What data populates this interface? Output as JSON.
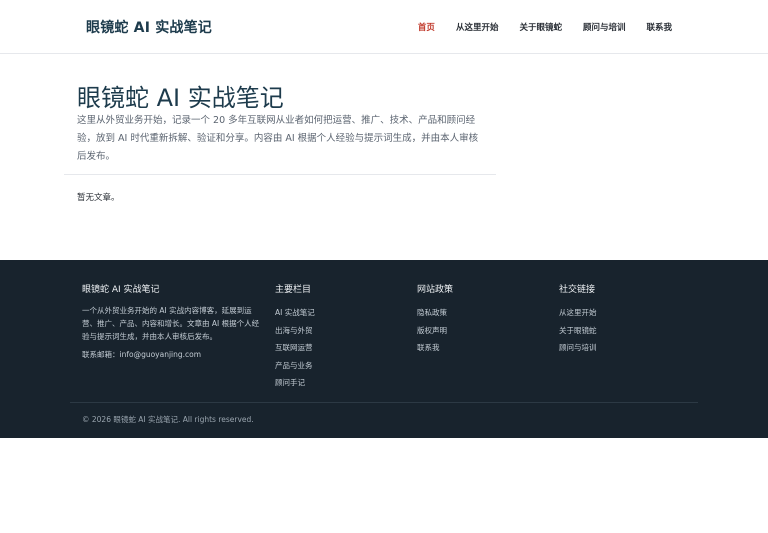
{
  "header": {
    "brand": "眼镜蛇 AI 实战笔记",
    "nav": [
      {
        "label": "首页",
        "active": true
      },
      {
        "label": "从这里开始"
      },
      {
        "label": "关于眼镜蛇"
      },
      {
        "label": "顾问与培训"
      },
      {
        "label": "联系我"
      }
    ]
  },
  "main": {
    "title": "眼镜蛇 AI 实战笔记",
    "description": "这里从外贸业务开始，记录一个 20 多年互联网从业者如何把运营、推广、技术、产品和顾问经验，放到 AI 时代重新拆解、验证和分享。内容由 AI 根据个人经验与提示词生成，并由本人审核后发布。",
    "empty_message": "暂无文章。"
  },
  "footer": {
    "about": {
      "title": "眼镜蛇 AI 实战笔记",
      "text": "一个从外贸业务开始的 AI 实战内容博客，延展到运营、推广、产品、内容和增长。文章由 AI 根据个人经验与提示词生成，并由本人审核后发布。",
      "contact": "联系邮箱：info@guoyanjing.com"
    },
    "columns": [
      {
        "title": "主要栏目",
        "items": [
          "AI 实战笔记",
          "出海与外贸",
          "互联网运营",
          "产品与业务",
          "顾问手记"
        ]
      },
      {
        "title": "网站政策",
        "items": [
          "隐私政策",
          "版权声明",
          "联系我"
        ]
      },
      {
        "title": "社交链接",
        "items": [
          "从这里开始",
          "关于眼镜蛇",
          "顾问与培训"
        ]
      }
    ],
    "copyright": "© 2026 眼镜蛇 AI 实战笔记. All rights reserved."
  }
}
